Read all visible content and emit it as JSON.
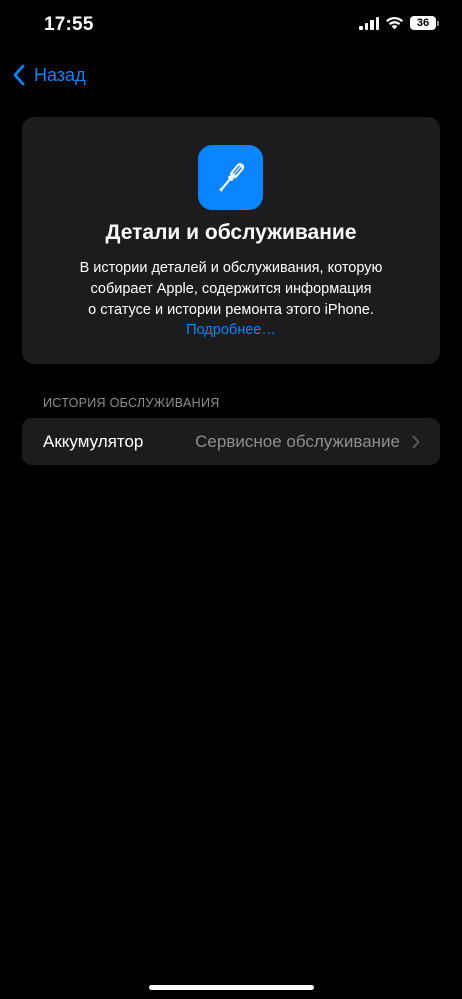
{
  "status_bar": {
    "time": "17:55",
    "battery": "36",
    "icons": [
      "cellular-signal-icon",
      "wifi-icon",
      "battery-icon"
    ]
  },
  "nav": {
    "back_label": "Назад",
    "accent_color": "#0a84ff"
  },
  "info_card": {
    "icon": "screwdriver-icon",
    "title": "Детали и обслуживание",
    "description_lines": [
      "В истории деталей и обслуживания, которую",
      "собирает Apple, содержится информация",
      "о статусе и истории ремонта этого iPhone."
    ],
    "link": "Подробнее…"
  },
  "service_history": {
    "header": "ИСТОРИЯ ОБСЛУЖИВАНИЯ",
    "rows": [
      {
        "label": "Аккумулятор",
        "value": "Сервисное обслуживание"
      }
    ]
  },
  "colors": {
    "background": "#000000",
    "card": "#1c1c1e",
    "secondary_text": "#8e8e93",
    "link": "#0a84ff"
  }
}
